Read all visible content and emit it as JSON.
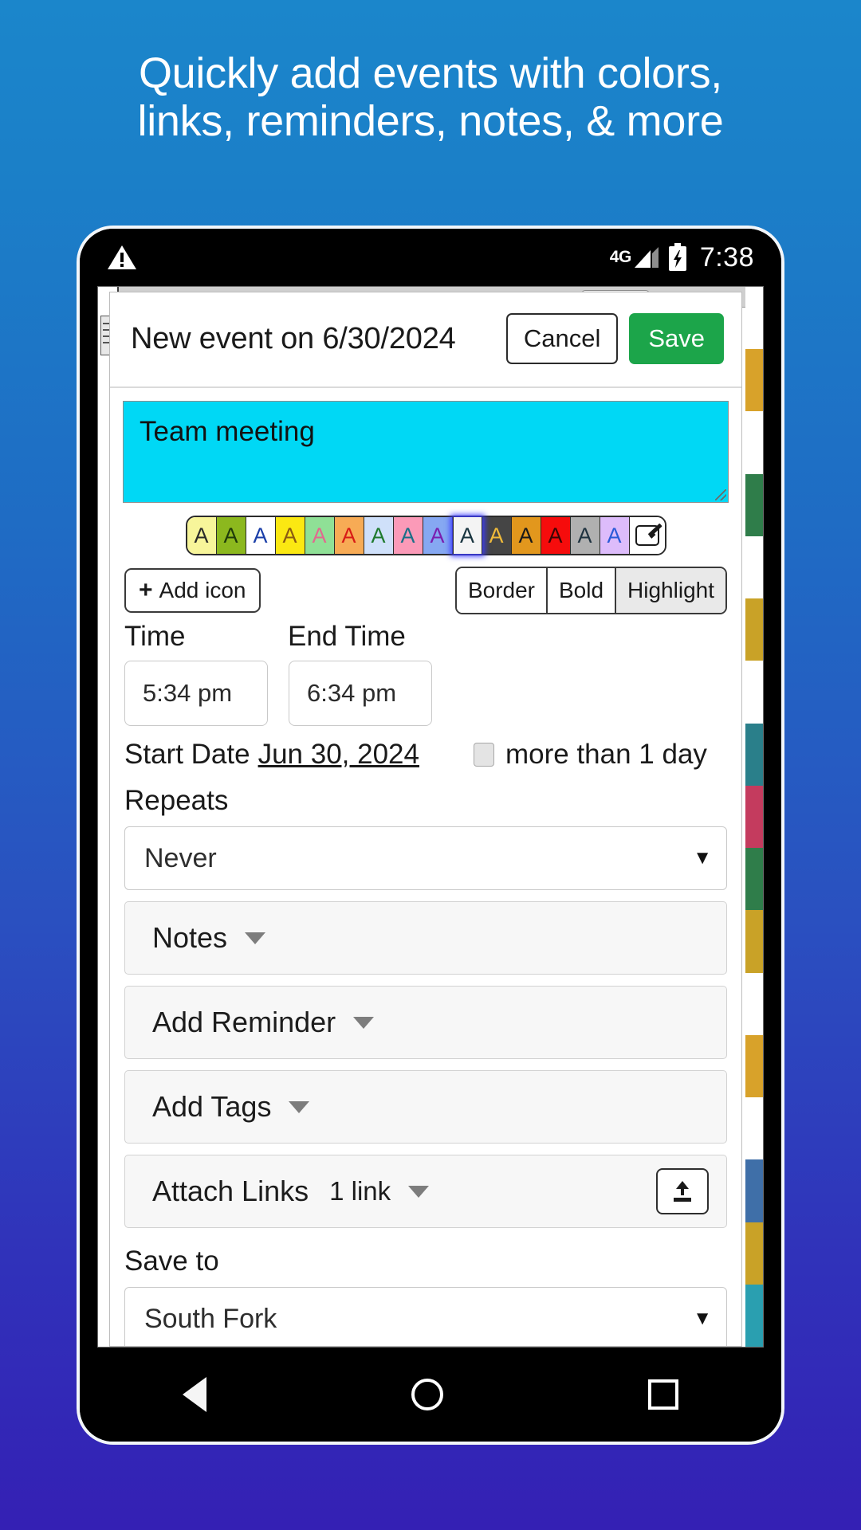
{
  "promo": {
    "line1": "Quickly add events with colors,",
    "line2": "links, reminders, notes, & more"
  },
  "statusbar": {
    "warning_icon": "warning-triangle-icon",
    "network": "4G",
    "signal_icon": "signal-bars-icon",
    "battery_icon": "battery-charging-icon",
    "time": "7:38"
  },
  "dialog": {
    "title": "New event on 6/30/2024",
    "cancel_label": "Cancel",
    "save_label": "Save",
    "event_title_value": "Team meeting",
    "event_title_bg": "#00d8f5"
  },
  "swatches": [
    {
      "bg": "#f7f59a",
      "fg": "#2b2b2b",
      "letter": "A"
    },
    {
      "bg": "#8cb81e",
      "fg": "#1f3b0a",
      "letter": "A"
    },
    {
      "bg": "#fbddа4",
      "fg": "#1a3ea8",
      "letter": "A"
    },
    {
      "bg": "#fbe812",
      "fg": "#8a5a12",
      "letter": "A"
    },
    {
      "bg": "#8fe096",
      "fg": "#e06a8f",
      "letter": "A"
    },
    {
      "bg": "#f7ab55",
      "fg": "#d81b16",
      "letter": "A"
    },
    {
      "bg": "#cfe0fa",
      "fg": "#1f7a2e",
      "letter": "A"
    },
    {
      "bg": "#fb9ab8",
      "fg": "#1b6f87",
      "letter": "A"
    },
    {
      "bg": "#86a8f2",
      "fg": "#7a1fb0",
      "letter": "A"
    },
    {
      "bg": "#f4f4f4",
      "fg": "#18343f",
      "letter": "A",
      "selected": true
    },
    {
      "bg": "#454545",
      "fg": "#f0bb3a",
      "letter": "A"
    },
    {
      "bg": "#e2971d",
      "fg": "#1a1a1a",
      "letter": "A"
    },
    {
      "bg": "#f60c0c",
      "fg": "#3a0505",
      "letter": "A"
    },
    {
      "bg": "#b0b0b0",
      "fg": "#1f3340",
      "letter": "A"
    },
    {
      "bg": "#ddbcfb",
      "fg": "#2b5bd8",
      "letter": "A"
    }
  ],
  "swatch_edit_icon": "pencil-edit-icon",
  "toolbar": {
    "add_icon_label": "Add icon",
    "add_icon_plus": "+",
    "border_label": "Border",
    "bold_label": "Bold",
    "highlight_label": "Highlight",
    "highlight_active": true
  },
  "time_section": {
    "start_label": "Time",
    "end_label": "End Time",
    "start_value": "5:34 pm",
    "end_value": "6:34 pm",
    "start_date_label": "Start Date",
    "start_date_value": "Jun 30, 2024",
    "more_than_one_day_label": "more than 1 day",
    "more_than_one_day_checked": false
  },
  "repeats": {
    "label": "Repeats",
    "value": "Never",
    "caret": "▼"
  },
  "panels": [
    {
      "label": "Notes",
      "sub": "",
      "has_upload": false
    },
    {
      "label": "Add Reminder",
      "sub": "",
      "has_upload": false
    },
    {
      "label": "Add Tags",
      "sub": "",
      "has_upload": false
    },
    {
      "label": "Attach Links",
      "sub": "1 link",
      "has_upload": true
    }
  ],
  "save_to": {
    "label": "Save to",
    "value": "South Fork",
    "caret": "▼"
  },
  "navbar": {
    "back": "back-triangle-icon",
    "home": "home-circle-icon",
    "recents": "recents-square-icon"
  },
  "background_calendar_colors": [
    "#ffffff",
    "#d8a22a",
    "#ffffff",
    "#2f7d4a",
    "#ffffff",
    "#c9a227",
    "#ffffff",
    "#2a7f8a",
    "#c43b5e",
    "#2f7d4a",
    "#c9a227",
    "#ffffff",
    "#d8a22a",
    "#ffffff",
    "#3f6fa8",
    "#c9a227",
    "#2a9fb0"
  ]
}
